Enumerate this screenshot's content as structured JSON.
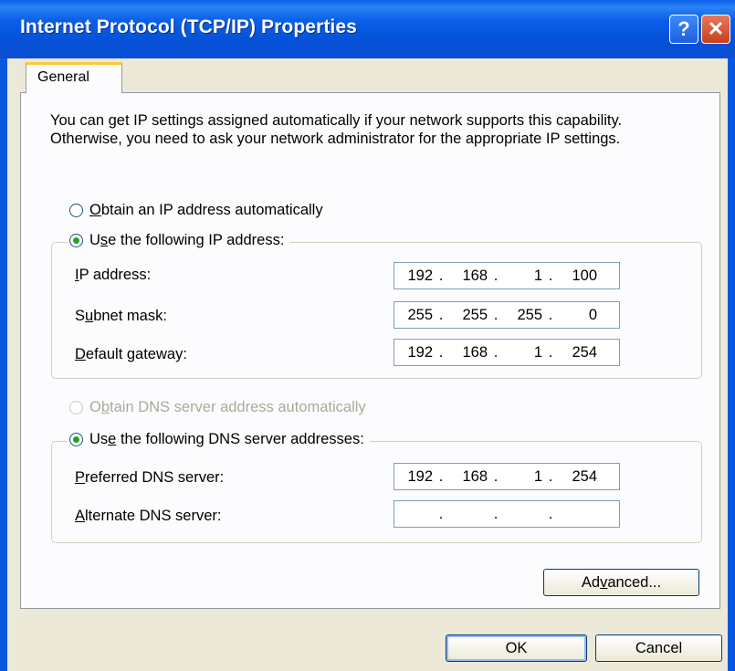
{
  "window": {
    "title": "Internet Protocol (TCP/IP) Properties",
    "help_label": "?",
    "close_label": "✕"
  },
  "tabs": [
    {
      "label": "General"
    }
  ],
  "intro_text": "You can get IP settings assigned automatically if your network supports this capability. Otherwise, you need to ask your network administrator for the appropriate IP settings.",
  "ip": {
    "auto_option": {
      "pre": "",
      "accel": "O",
      "post": "btain an IP address automatically",
      "selected": false
    },
    "manual_option": {
      "pre": "U",
      "accel": "s",
      "post": "e the following IP address:",
      "selected": true
    },
    "fields": [
      {
        "pre": "",
        "accel": "I",
        "post": "P address:",
        "octets": [
          "192",
          "168",
          "1",
          "100"
        ]
      },
      {
        "pre": "S",
        "accel": "u",
        "post": "bnet mask:",
        "octets": [
          "255",
          "255",
          "255",
          "0"
        ]
      },
      {
        "pre": "",
        "accel": "D",
        "post": "efault gateway:",
        "octets": [
          "192",
          "168",
          "1",
          "254"
        ]
      }
    ]
  },
  "dns": {
    "auto_option": {
      "pre": "O",
      "accel": "b",
      "post": "tain DNS server address automatically",
      "selected": false,
      "disabled": true
    },
    "manual_option": {
      "pre": "Us",
      "accel": "e",
      "post": " the following DNS server addresses:",
      "selected": true
    },
    "fields": [
      {
        "pre": "",
        "accel": "P",
        "post": "referred DNS server:",
        "octets": [
          "192",
          "168",
          "1",
          "254"
        ]
      },
      {
        "pre": "",
        "accel": "A",
        "post": "lternate DNS server:",
        "octets": [
          "",
          "",
          "",
          ""
        ]
      }
    ]
  },
  "buttons": {
    "advanced": {
      "pre": "Ad",
      "accel": "v",
      "post": "anced..."
    },
    "ok": "OK",
    "cancel": "Cancel"
  },
  "colors": {
    "titlebar": "#0a5fe8",
    "radio_dot": "#21a121",
    "dialog_bg": "#ece9d8"
  }
}
